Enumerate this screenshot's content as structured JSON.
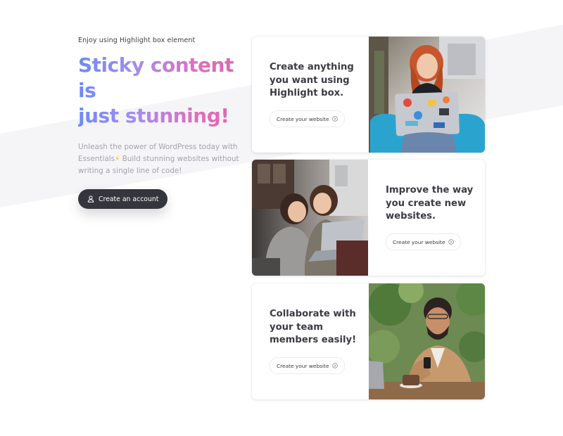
{
  "hero": {
    "eyebrow": "Enjoy using Highlight box element",
    "headline_line1": "Sticky content is",
    "headline_line2": "just stunning!",
    "description_part1": "Unleash the power of WordPress today with Essentials",
    "description_emoji": "⚡",
    "description_part2": " Build stunning websites without writing a single line of code!",
    "cta_label": "Create an account",
    "cta_icon": "user-icon"
  },
  "cards": [
    {
      "title": "Create anything you want using Highlight box.",
      "button_label": "Create your website",
      "button_icon": "arrow-circle-icon",
      "image": "woman-with-laptop-photo"
    },
    {
      "title": "Improve the way you create new websites.",
      "button_label": "Create your website",
      "button_icon": "arrow-circle-icon",
      "image": "two-women-with-laptop-photo"
    },
    {
      "title": "Collaborate with your team members easily!",
      "button_label": "Create your website",
      "button_icon": "arrow-circle-icon",
      "image": "man-with-phone-photo"
    }
  ],
  "colors": {
    "gradient_start": "#6d8bf5",
    "gradient_end": "#e063aa",
    "cta_bg": "#35363d",
    "text_dark": "#3b3b42",
    "text_muted": "#a3a3ab",
    "band": "#f5f5f8"
  }
}
